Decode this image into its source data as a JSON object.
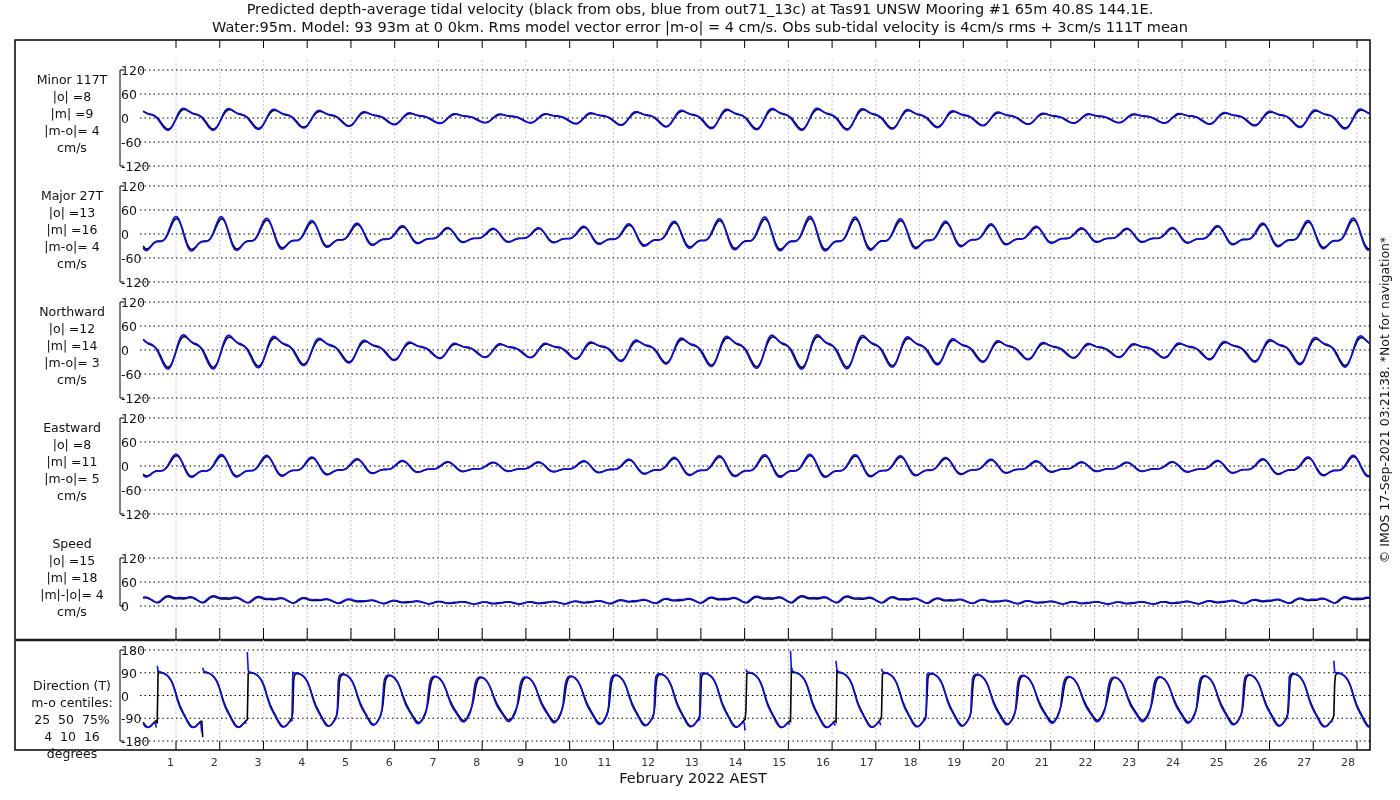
{
  "title_lines": [
    "Predicted depth-average tidal velocity (black from obs, blue from out71_13c) at Tas91 UNSW Mooring #1 65m 40.8S 144.1E.",
    "Water:95m. Model: 93 93m at 0 0km. Rms model vector error |m-o| = 4 cm/s. Obs sub-tidal velocity is 4cm/s rms + 3cm/s 111T mean"
  ],
  "panels": [
    {
      "kind": "signed",
      "label_lines": [
        "Minor 117T",
        "|o| =8",
        "|m| =9",
        "|m-o|= 4",
        "cm/s"
      ],
      "yticks": [
        "120",
        "60",
        "0",
        "-60",
        "-120"
      ]
    },
    {
      "kind": "signed",
      "label_lines": [
        "Major 27T",
        "|o| =13",
        "|m| =16",
        "|m-o|= 4",
        "cm/s"
      ],
      "yticks": [
        "120",
        "60",
        "0",
        "-60",
        "-120"
      ]
    },
    {
      "kind": "signed",
      "label_lines": [
        "Northward",
        "|o| =12",
        "|m| =14",
        "|m-o|= 3",
        "cm/s"
      ],
      "yticks": [
        "120",
        "60",
        "0",
        "-60",
        "-120"
      ]
    },
    {
      "kind": "signed",
      "label_lines": [
        "Eastward",
        "|o| =8",
        "|m| =11",
        "|m-o|= 5",
        "cm/s"
      ],
      "yticks": [
        "120",
        "60",
        "0",
        "-60",
        "-120"
      ]
    },
    {
      "kind": "speed",
      "label_lines": [
        "Speed",
        "|o| =15",
        "|m| =18",
        "|m|-|o|= 4",
        "cm/s"
      ],
      "yticks": [
        "120",
        "60",
        "0"
      ]
    },
    {
      "kind": "direction",
      "label_lines": [
        "Direction (T)",
        "m-o centiles:",
        "25  50  75%",
        "4  10  16",
        "degrees"
      ],
      "yticks": [
        "180",
        "90",
        "0",
        "-90",
        "-180"
      ]
    }
  ],
  "xticks": [
    "1",
    "2",
    "3",
    "4",
    "5",
    "6",
    "7",
    "8",
    "9",
    "10",
    "11",
    "12",
    "13",
    "14",
    "15",
    "16",
    "17",
    "18",
    "19",
    "20",
    "21",
    "22",
    "23",
    "24",
    "25",
    "26",
    "27",
    "28"
  ],
  "xlabel": "February 2022 AEST",
  "footnote": "© IMOS 17-Sep-2021 03:21:38. *Not for navigation*"
}
